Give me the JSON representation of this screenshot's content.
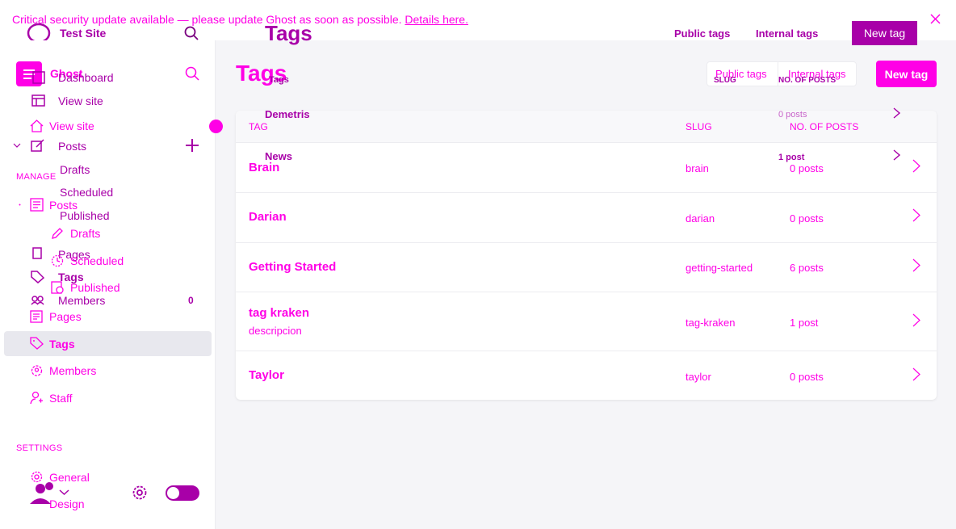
{
  "banner": {
    "message": "Critical security update available — please update Ghost as soon as possible.",
    "link": "Details here."
  },
  "site": {
    "name": "Test Site",
    "brand": "Ghost"
  },
  "page_header": {
    "title": "Tags",
    "ghost_title": "Tags"
  },
  "tabs": {
    "public": "Public tags",
    "internal": "Internal tags"
  },
  "new_tag_label": "New tag",
  "nav_primary": {
    "dashboard": "Dashboard",
    "view_site": "View site",
    "posts": "Posts",
    "drafts": "Drafts",
    "scheduled": "Scheduled",
    "published": "Published",
    "pages": "Pages",
    "tags": "Tags",
    "members": "Members",
    "members_count": "0"
  },
  "nav_secondary": {
    "view_site": "View site",
    "manage_header": "MANAGE",
    "posts": "Posts",
    "drafts": "Drafts",
    "scheduled": "Scheduled",
    "published": "Published",
    "pages": "Pages",
    "tags": "Tags",
    "members": "Members",
    "staff": "Staff",
    "settings_header": "SETTINGS",
    "general": "General",
    "design": "Design"
  },
  "ghost_list": {
    "col_slug": "SLUG",
    "col_posts": "NO. OF POSTS",
    "row1_name": "Demetris",
    "row1_posts": "0 posts",
    "row2_name": "News",
    "row2_posts": "1 post"
  },
  "table": {
    "headers": {
      "tag": "TAG",
      "slug": "SLUG",
      "posts": "NO. OF POSTS"
    },
    "rows": [
      {
        "name": "Brain",
        "description": "",
        "slug": "brain",
        "posts": "0 posts"
      },
      {
        "name": "Darian",
        "description": "",
        "slug": "darian",
        "posts": "0 posts"
      },
      {
        "name": "Getting Started",
        "description": "",
        "slug": "getting-started",
        "posts": "6 posts"
      },
      {
        "name": "tag kraken",
        "description": "descripcion",
        "slug": "tag-kraken",
        "posts": "1 post"
      },
      {
        "name": "Taylor",
        "description": "",
        "slug": "taylor",
        "posts": "0 posts"
      }
    ]
  },
  "colors": {
    "accent": "#ff00e6",
    "accent_dark": "#a800a8",
    "background": "#f5f5f8"
  }
}
